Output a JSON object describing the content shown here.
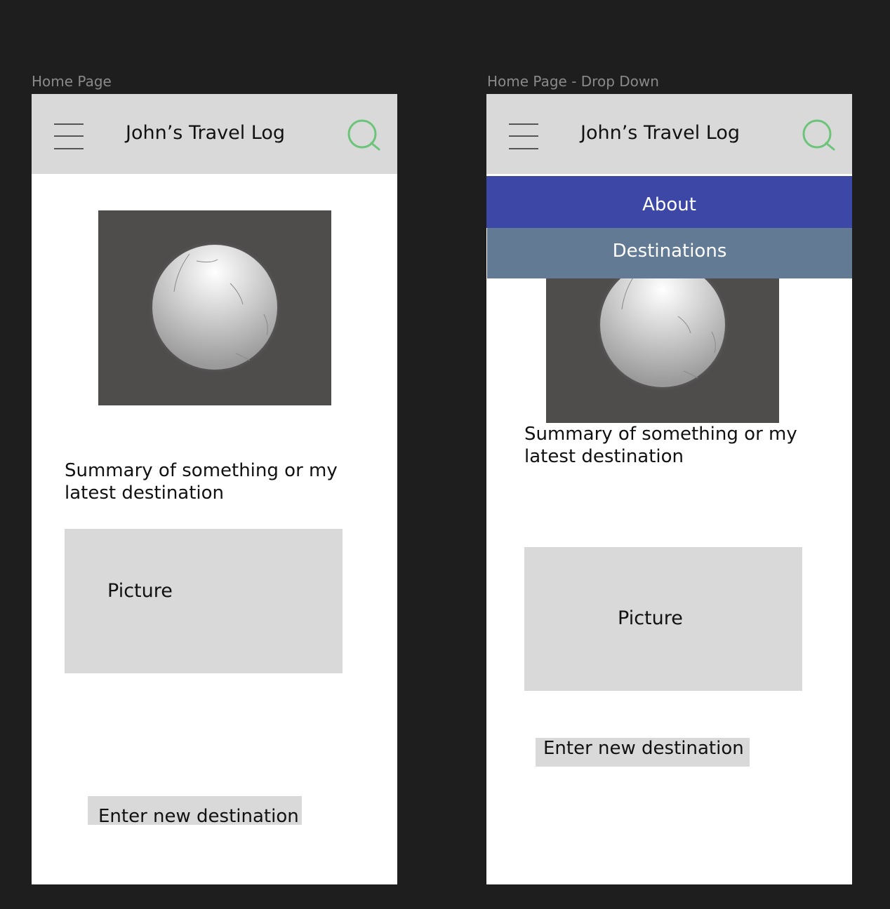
{
  "frames": {
    "home": {
      "label": "Home Page",
      "title": "John’s Travel Log",
      "summary": "Summary of something or my latest destination",
      "picture_label": "Picture",
      "cta_label": "Enter new destination",
      "icons": {
        "menu": "hamburger-menu-icon",
        "search": "search-icon"
      }
    },
    "dropdown": {
      "label": "Home Page - Drop Down",
      "title": "John’s Travel Log",
      "menu": {
        "about": "About",
        "destinations": "Destinations"
      },
      "summary": "Summary of something or my latest destination",
      "picture_label": "Picture",
      "cta_label": "Enter new destination",
      "icons": {
        "menu": "hamburger-menu-icon",
        "search": "search-icon"
      }
    }
  },
  "colors": {
    "canvas": "#1e1e1e",
    "header": "#d9d9d9",
    "search_icon": "#6cc47a",
    "menu_about": "#3c47a6",
    "menu_destinations": "#627a94",
    "hero_background": "#4f4c4c"
  }
}
